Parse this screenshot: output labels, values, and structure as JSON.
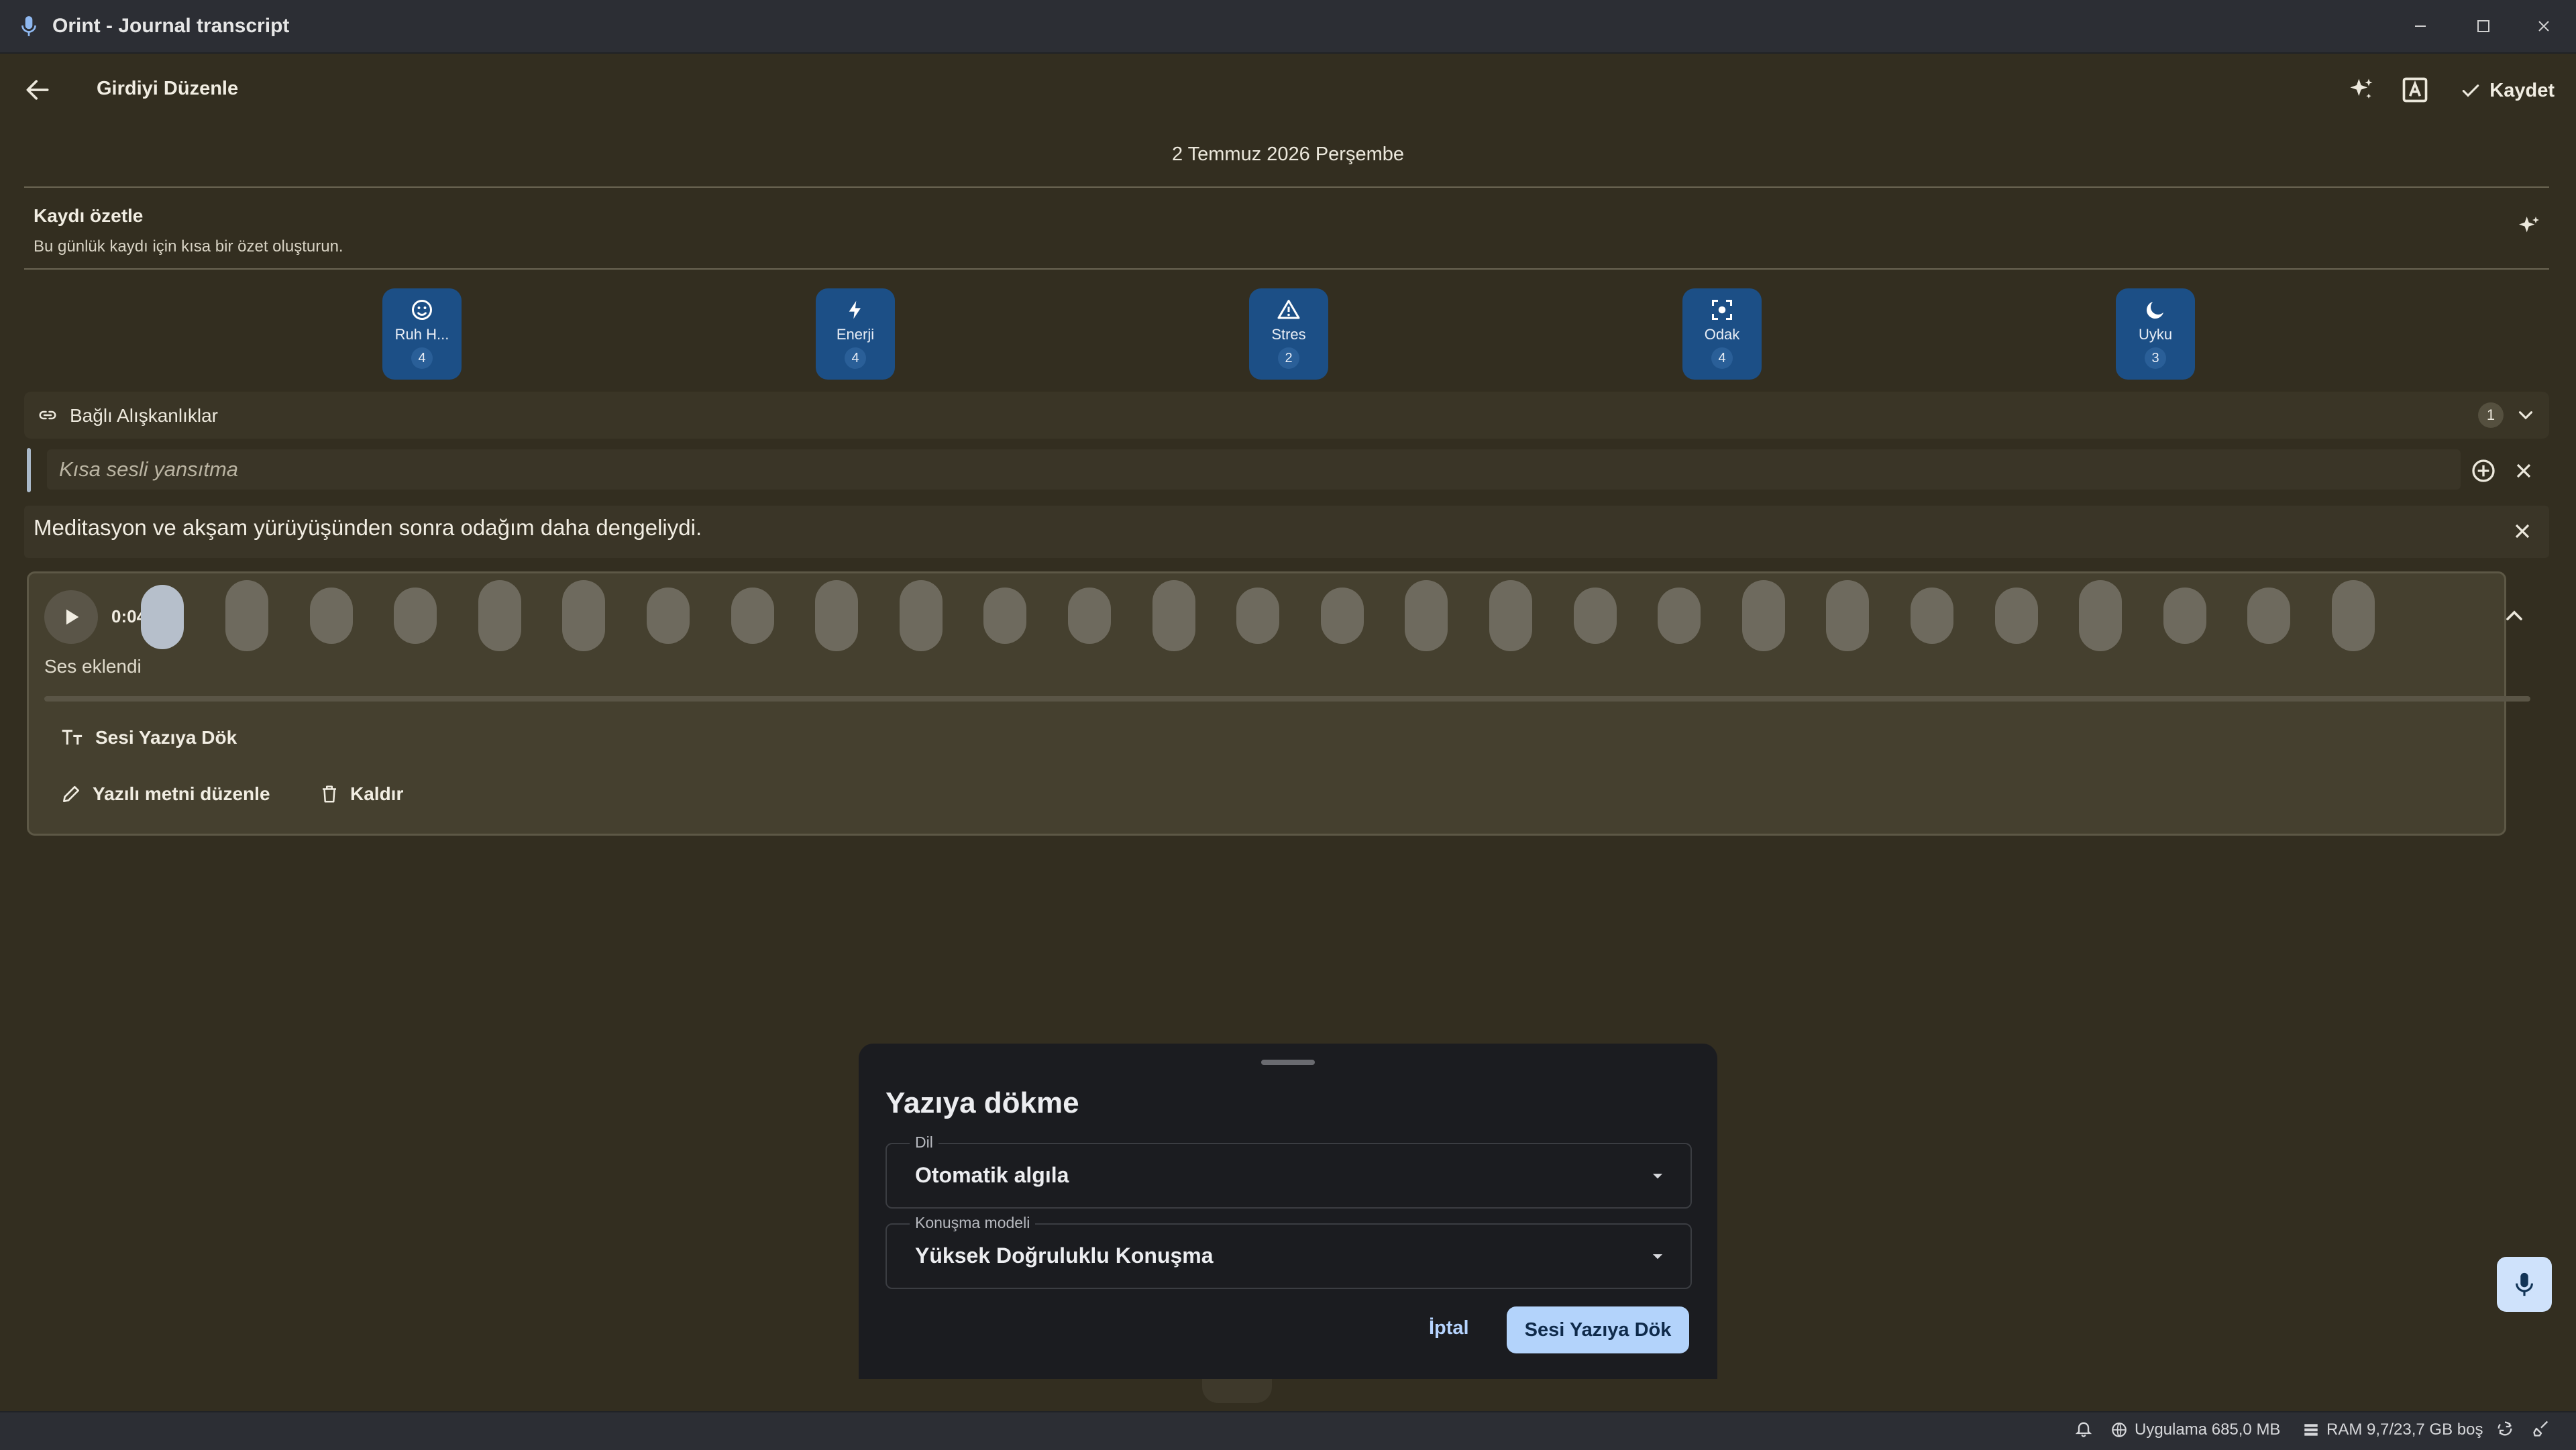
{
  "window": {
    "title": "Orint - Journal transcript"
  },
  "appbar": {
    "title": "Girdiyi Düzenle",
    "save_label": "Kaydet"
  },
  "entry": {
    "date": "2 Temmuz 2026 Perşembe"
  },
  "summary": {
    "title": "Kaydı özetle",
    "subtitle": "Bu günlük kaydı için kısa bir özet oluşturun."
  },
  "metrics": [
    {
      "label": "Ruh H...",
      "value": "4",
      "icon": "smile-icon"
    },
    {
      "label": "Enerji",
      "value": "4",
      "icon": "bolt-icon"
    },
    {
      "label": "Stres",
      "value": "2",
      "icon": "warning-icon"
    },
    {
      "label": "Odak",
      "value": "4",
      "icon": "focus-icon"
    },
    {
      "label": "Uyku",
      "value": "3",
      "icon": "moon-icon"
    }
  ],
  "habits": {
    "label": "Bağlı Alışkanlıklar",
    "count": "1"
  },
  "reflection": {
    "placeholder": "Kısa sesli yansıtma",
    "value": ""
  },
  "note": {
    "text": "Meditasyon ve akşam yürüyüşünden sonra odağım daha dengeliydi."
  },
  "audio": {
    "time": "0:04",
    "status": "Ses eklendi",
    "transcribe_label": "Sesi Yazıya Dök",
    "edit_label": "Yazılı metni düzenle",
    "remove_label": "Kaldır"
  },
  "sheet": {
    "title": "Yazıya dökme",
    "language_label": "Dil",
    "language_value": "Otomatik algıla",
    "model_label": "Konuşma modeli",
    "model_value": "Yüksek Doğruluklu Konuşma",
    "cancel_label": "İptal",
    "submit_label": "Sesi Yazıya Dök"
  },
  "statusbar": {
    "app_memory": "Uygulama 685,0 MB",
    "ram": "RAM 9,7/23,7 GB boş"
  },
  "colors": {
    "background": "#332e20",
    "chip": "#1c4f86",
    "primary_button": "#b3d3fb",
    "sheet": "#1b1c20"
  }
}
